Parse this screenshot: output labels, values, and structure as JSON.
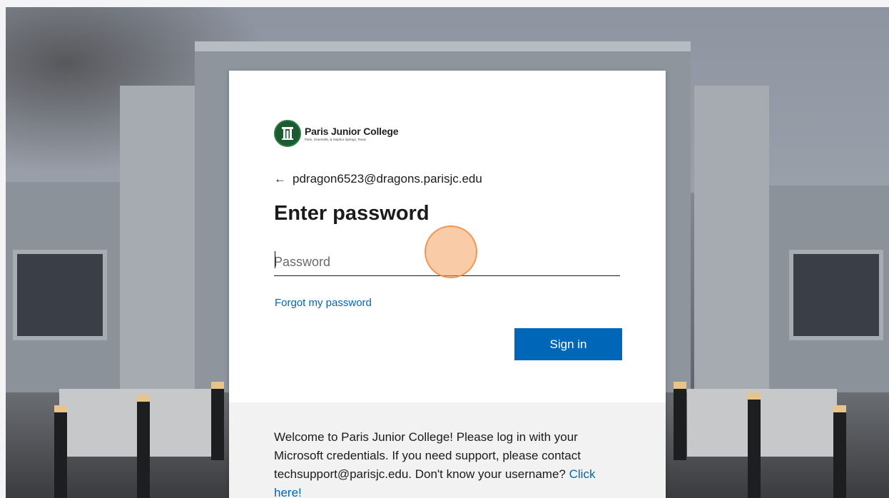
{
  "brand": {
    "name": "Paris Junior College",
    "tagline": "Paris, Greenville, & Sulphur Springs, Texas",
    "color": "#1c5a2f"
  },
  "identity": {
    "back_icon": "arrow-left-icon",
    "email": "pdragon6523@dragons.parisjc.edu"
  },
  "form": {
    "title": "Enter password",
    "password_placeholder": "Password",
    "password_value": "",
    "forgot_link": "Forgot my password",
    "signin_label": "Sign in"
  },
  "footer": {
    "message": "Welcome to Paris Junior College! Please log in with your Microsoft credentials. If you need support, please contact techsupport@parisjc.edu. Don't know your username?",
    "link": "Click here!"
  },
  "colors": {
    "accent": "#0067b8",
    "footer_bg": "#f2f2f2",
    "cursor_highlight": "#f5a05f"
  }
}
